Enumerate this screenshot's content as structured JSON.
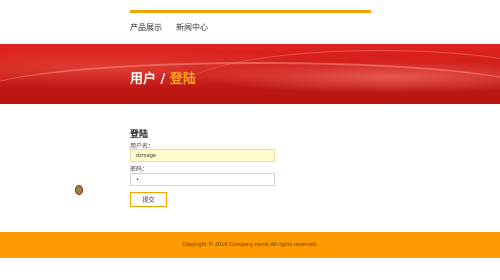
{
  "nav": {
    "items": [
      {
        "label": "产品展示"
      },
      {
        "label": "新闻中心"
      }
    ]
  },
  "hero": {
    "title_main": "用户",
    "title_sep": " / ",
    "title_accent": "登陆"
  },
  "login": {
    "heading": "登陆",
    "username_label": "用户名：",
    "username_value": "dzmage",
    "password_label": "密码：",
    "password_value": "•",
    "submit_label": "提交"
  },
  "footer": {
    "copyright": "Copyright © 2016 Company name All rights reserved."
  },
  "colors": {
    "accent": "#f2a400",
    "hero_red": "#d41d1a",
    "footer": "#ff9a00"
  }
}
